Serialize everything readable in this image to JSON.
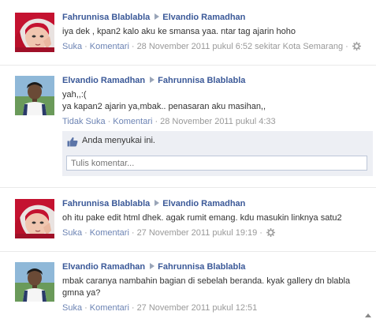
{
  "posts": [
    {
      "author": "Fahrunnisa Blablabla",
      "target": "Elvandio Ramadhan",
      "message": "iya dek , kpan2 kalo aku ke smansa yaa. ntar tag ajarin hoho",
      "like_label": "Suka",
      "comment_label": "Komentari",
      "timestamp": "28 November 2011 pukul 6:52 sekitar Kota Semarang"
    },
    {
      "author": "Elvandio Ramadhan",
      "target": "Fahrunnisa Blablabla",
      "message": "yah,,:(\nya kapan2 ajarin ya,mbak.. penasaran aku masihan,,",
      "like_label": "Tidak Suka",
      "comment_label": "Komentari",
      "timestamp": "28 November 2011 pukul 4:33",
      "likes_text": "Anda menyukai ini.",
      "comment_placeholder": "Tulis komentar..."
    },
    {
      "author": "Fahrunnisa Blablabla",
      "target": "Elvandio Ramadhan",
      "message": "oh itu pake edit html dhek. agak rumit emang. kdu masukin linknya satu2",
      "like_label": "Suka",
      "comment_label": "Komentari",
      "timestamp": "27 November 2011 pukul 19:19"
    },
    {
      "author": "Elvandio Ramadhan",
      "target": "Fahrunnisa Blablabla",
      "message": "mbak caranya nambahin bagian di sebelah beranda. kyak gallery dn blabla gmna ya?",
      "like_label": "Suka",
      "comment_label": "Komentari",
      "timestamp": "27 November 2011 pukul 12:51"
    }
  ],
  "separator_dot": "·",
  "icons": {
    "gear": "gear-icon",
    "thumb": "thumbs-up-icon",
    "arrow": "triangle-right-icon"
  },
  "colors": {
    "link": "#3b5998",
    "meta_link": "#6d84b4",
    "meta_text": "#999999",
    "like_bg": "#edeff4"
  }
}
